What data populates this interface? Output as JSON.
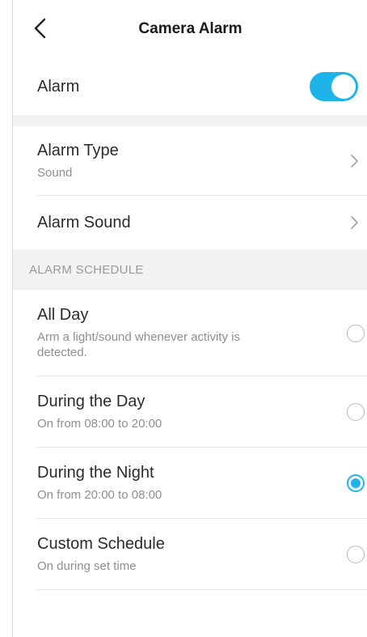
{
  "header": {
    "title": "Camera Alarm",
    "back_icon": "chevron-left-icon"
  },
  "alarm": {
    "label": "Alarm",
    "enabled": true,
    "accent": "#1fb4e9"
  },
  "settings": [
    {
      "label": "Alarm Type",
      "value": "Sound"
    },
    {
      "label": "Alarm Sound",
      "value": ""
    }
  ],
  "schedule": {
    "section_title": "ALARM SCHEDULE",
    "selected": 2,
    "options": [
      {
        "label": "All Day",
        "description": "Arm a light/sound whenever activity is detected."
      },
      {
        "label": "During the Day",
        "description": "On from 08:00 to 20:00"
      },
      {
        "label": "During the Night",
        "description": "On from 20:00 to 08:00"
      },
      {
        "label": "Custom Schedule",
        "description": "On during set time"
      }
    ]
  }
}
